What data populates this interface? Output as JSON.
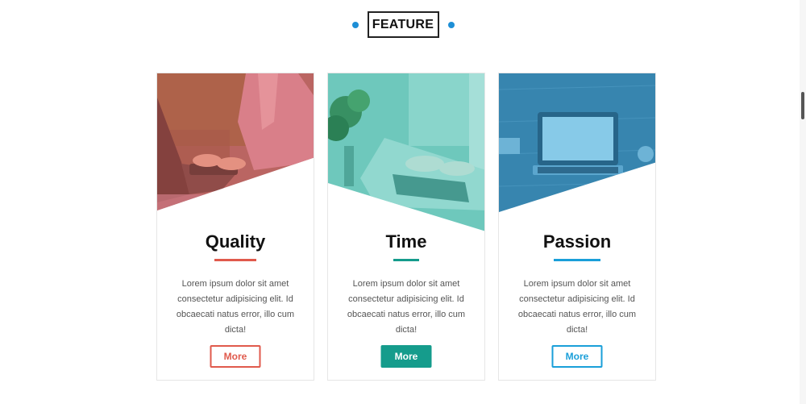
{
  "section": {
    "heading": "FEATURE",
    "accent_color": "#1e8fd6"
  },
  "cards": [
    {
      "title": "Quality",
      "text": "Lorem ipsum dolor sit amet consectetur adipisicing elit. Id obcaecati natus error, illo cum dicta!",
      "button_label": "More",
      "accent_color": "#e05a4c",
      "button_style": "outlined",
      "image_icon": "laptop-typing-photo"
    },
    {
      "title": "Time",
      "text": "Lorem ipsum dolor sit amet consectetur adipisicing elit. Id obcaecati natus error, illo cum dicta!",
      "button_label": "More",
      "accent_color": "#159c8c",
      "button_style": "filled",
      "image_icon": "hands-on-keyboard-photo"
    },
    {
      "title": "Passion",
      "text": "Lorem ipsum dolor sit amet consectetur adipisicing elit. Id obcaecati natus error, illo cum dicta!",
      "button_label": "More",
      "accent_color": "#1a9fd9",
      "button_style": "outlined",
      "image_icon": "laptop-on-desk-photo"
    }
  ]
}
